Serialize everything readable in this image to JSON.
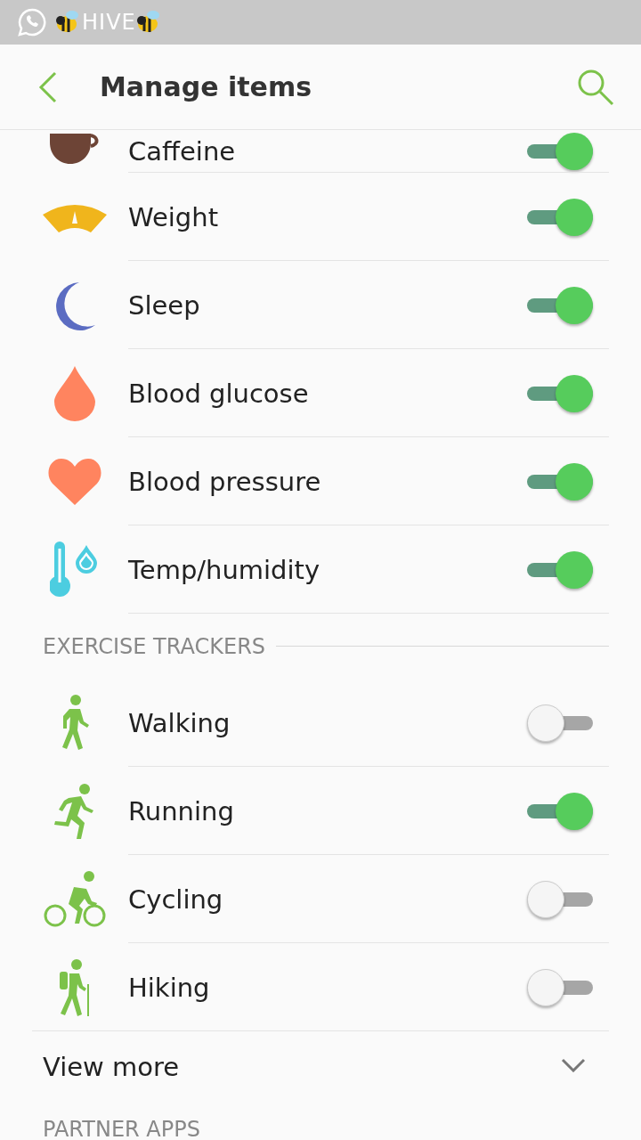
{
  "status_bar": {
    "notification": "HIVE"
  },
  "header": {
    "title": "Manage items"
  },
  "sections": [
    {
      "items": [
        {
          "kind": "cup",
          "label": "Caffeine",
          "on": true
        },
        {
          "kind": "gauge",
          "label": "Weight",
          "on": true
        },
        {
          "kind": "moon",
          "label": "Sleep",
          "on": true
        },
        {
          "kind": "drop",
          "label": "Blood glucose",
          "on": true
        },
        {
          "kind": "heart",
          "label": "Blood pressure",
          "on": true
        },
        {
          "kind": "thermometer",
          "label": "Temp/humidity",
          "on": true
        }
      ]
    },
    {
      "title": "EXERCISE TRACKERS",
      "items": [
        {
          "kind": "walk",
          "label": "Walking",
          "on": false
        },
        {
          "kind": "run",
          "label": "Running",
          "on": true
        },
        {
          "kind": "bike",
          "label": "Cycling",
          "on": false
        },
        {
          "kind": "hike",
          "label": "Hiking",
          "on": false
        }
      ],
      "more": "View more"
    },
    {
      "title": "PARTNER APPS"
    }
  ]
}
